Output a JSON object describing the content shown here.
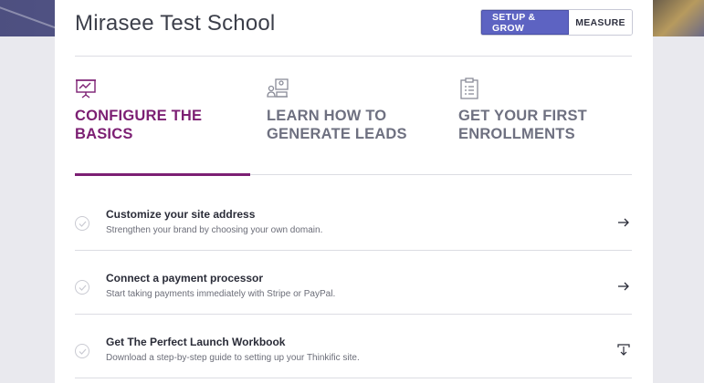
{
  "header": {
    "school_title": "Mirasee Test School",
    "setup_grow_label": "SETUP & GROW",
    "measure_label": "MEASURE"
  },
  "tabs": [
    {
      "label": "CONFIGURE THE BASICS",
      "line1": "CONFIGURE THE",
      "line2": "BASICS",
      "icon": "presentation-chart-icon",
      "active": true
    },
    {
      "label": "LEARN HOW TO GENERATE LEADS",
      "line1": "LEARN HOW TO",
      "line2": "GENERATE LEADS",
      "icon": "users-screen-icon",
      "active": false
    },
    {
      "label": "GET YOUR FIRST ENROLLMENTS",
      "line1": "GET YOUR FIRST",
      "line2": "ENROLLMENTS",
      "icon": "clipboard-list-icon",
      "active": false
    }
  ],
  "tasks": [
    {
      "title": "Customize your site address",
      "description": "Strengthen your brand by choosing your own domain.",
      "action_icon": "arrow-right-icon"
    },
    {
      "title": "Connect a payment processor",
      "description": "Start taking payments immediately with Stripe or PayPal.",
      "action_icon": "arrow-right-icon"
    },
    {
      "title": "Get The Perfect Launch Workbook",
      "description": "Download a step-by-step guide to setting up your Thinkific site.",
      "action_icon": "download-icon"
    }
  ],
  "colors": {
    "accent_purple": "#7c1f73",
    "primary_button": "#5d63c2",
    "banner": "#5a5c8c"
  }
}
